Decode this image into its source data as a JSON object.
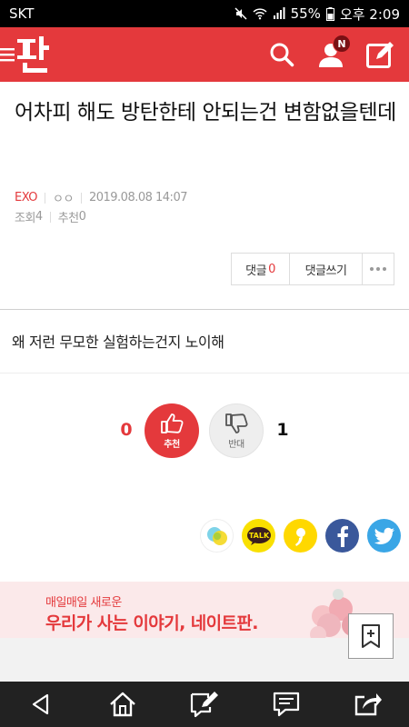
{
  "status_bar": {
    "carrier": "SKT",
    "battery": "55%",
    "time": "오후 2:09"
  },
  "header": {
    "logo_text": "판",
    "accent_color": "#e4393c",
    "notification_badge": "N",
    "icons": [
      "menu-icon",
      "search-icon",
      "user-icon",
      "write-icon"
    ]
  },
  "post": {
    "title": "어차피 해도 방탄한테 안되는건 변함없을텐데",
    "category": "EXO",
    "author": "ㅇㅇ",
    "date": "2019.08.08 14:07",
    "views_label": "조회",
    "views": "4",
    "recommend_label": "추천",
    "recommend": "0",
    "body": "왜 저런 무모한 실험하는건지 노이해"
  },
  "comments": {
    "label": "댓글",
    "count": "0",
    "write_label": "댓글쓰기"
  },
  "vote": {
    "up_count": "0",
    "up_label": "추천",
    "down_label": "반대",
    "down_count": "1"
  },
  "share": {
    "kakaotalk_label": "TALK"
  },
  "banner": {
    "subtitle": "매일매일 새로운",
    "title": "우리가 사는 이야기, 네이트판."
  }
}
